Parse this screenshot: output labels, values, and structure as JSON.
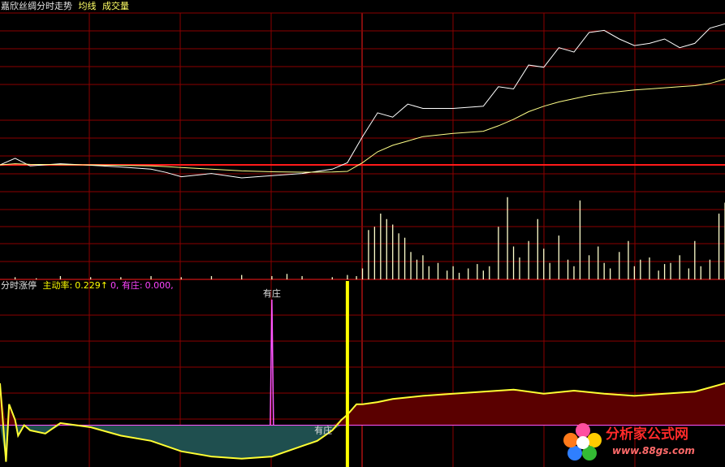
{
  "panel_top": {
    "title": "嘉欣丝绸分时走势",
    "legend": [
      "均线",
      "成交量"
    ],
    "legend_colors": [
      "#ffff66",
      "#ffff66"
    ]
  },
  "panel_indicator": {
    "name": "分时涨停",
    "metric_label": "主动率:",
    "metric_value": "0.229",
    "arrow": "↑",
    "second_value": "0,",
    "zhuang_label": "有庄:",
    "zhuang_value": "0.000,",
    "spike_label": "有庄",
    "base_label": "有庄"
  },
  "colors": {
    "background": "#000000",
    "grid": "#8b0000",
    "grid_bright": "#ff1a1a",
    "price_line": "#ffffff",
    "avg_line": "#ffff88",
    "volume_bar": "#ffffcc",
    "indicator_line": "#ffff33",
    "fill_below": "#1f4f4f",
    "fill_above": "#5a0000",
    "spike": "#ff55ff",
    "marker": "#ffff00",
    "text_white": "#e0e0e0",
    "text_yellow": "#ffff00",
    "text_magenta": "#ff44ff"
  },
  "watermark": {
    "name": "分析家公式网",
    "url": "www.88gs.com"
  },
  "chart_data": [
    {
      "type": "line",
      "title": "嘉欣丝绸分时走势",
      "x": [
        0,
        5,
        10,
        20,
        30,
        40,
        50,
        55,
        60,
        70,
        80,
        90,
        100,
        110,
        115,
        120,
        125,
        130,
        135,
        140,
        150,
        160,
        165,
        170,
        175,
        180,
        185,
        190,
        195,
        200,
        205,
        210,
        215,
        220,
        225,
        230,
        235,
        240
      ],
      "series": [
        {
          "name": "",
          "values": [
            0,
            0.3,
            -0.05,
            0.05,
            -0.02,
            -0.1,
            -0.2,
            -0.35,
            -0.55,
            -0.4,
            -0.6,
            -0.5,
            -0.4,
            -0.2,
            0.1,
            1.3,
            2.4,
            2.2,
            2.8,
            2.6,
            2.6,
            2.7,
            3.6,
            3.5,
            4.6,
            4.5,
            5.4,
            5.2,
            6.1,
            6.2,
            5.8,
            5.5,
            5.6,
            5.8,
            5.4,
            5.6,
            6.3,
            6.5
          ]
        },
        {
          "name": "均线",
          "values": [
            0,
            0.05,
            0.02,
            0.01,
            0,
            -0.02,
            -0.05,
            -0.08,
            -0.12,
            -0.2,
            -0.28,
            -0.32,
            -0.34,
            -0.33,
            -0.3,
            0.1,
            0.6,
            0.9,
            1.1,
            1.3,
            1.45,
            1.55,
            1.8,
            2.1,
            2.45,
            2.7,
            2.9,
            3.05,
            3.2,
            3.3,
            3.38,
            3.45,
            3.5,
            3.55,
            3.6,
            3.65,
            3.75,
            3.95
          ]
        }
      ],
      "ylim": [
        -1.2,
        7.0
      ],
      "xlim": [
        0,
        240
      ]
    },
    {
      "type": "bar",
      "title": "成交量",
      "x": [
        5,
        12,
        20,
        30,
        40,
        50,
        60,
        70,
        80,
        90,
        95,
        100,
        110,
        115,
        118,
        120,
        122,
        124,
        126,
        128,
        130,
        132,
        134,
        136,
        138,
        140,
        142,
        145,
        148,
        150,
        152,
        155,
        158,
        160,
        162,
        165,
        168,
        170,
        172,
        175,
        178,
        180,
        182,
        185,
        188,
        190,
        192,
        195,
        198,
        200,
        202,
        205,
        208,
        210,
        212,
        215,
        218,
        220,
        222,
        225,
        228,
        230,
        232,
        235,
        238,
        240
      ],
      "values": [
        2,
        1,
        3,
        2,
        2,
        3,
        2,
        3,
        4,
        3,
        5,
        3,
        2,
        4,
        3,
        10,
        45,
        48,
        60,
        55,
        50,
        42,
        38,
        25,
        18,
        22,
        12,
        15,
        8,
        12,
        6,
        10,
        14,
        8,
        12,
        48,
        75,
        30,
        20,
        35,
        55,
        28,
        15,
        40,
        18,
        12,
        72,
        22,
        30,
        15,
        10,
        25,
        35,
        12,
        18,
        20,
        8,
        14,
        15,
        22,
        10,
        35,
        12,
        18,
        60,
        70
      ],
      "ylim": [
        0,
        80
      ],
      "xlim": [
        0,
        240
      ]
    },
    {
      "type": "area",
      "title": "分时涨停",
      "x": [
        0,
        2,
        3,
        5,
        6,
        8,
        10,
        15,
        20,
        30,
        40,
        50,
        60,
        70,
        80,
        90,
        100,
        105,
        110,
        113,
        115,
        118,
        120,
        125,
        130,
        140,
        150,
        160,
        170,
        180,
        190,
        200,
        210,
        220,
        230,
        235,
        240
      ],
      "series": [
        {
          "name": "",
          "values": [
            0.4,
            -0.35,
            0.2,
            0.05,
            -0.1,
            0,
            -0.05,
            -0.08,
            0.02,
            -0.02,
            -0.1,
            -0.15,
            -0.25,
            -0.3,
            -0.32,
            -0.3,
            -0.2,
            -0.15,
            -0.05,
            0.05,
            0.1,
            0.2,
            0.2,
            0.22,
            0.25,
            0.28,
            0.3,
            0.32,
            0.34,
            0.3,
            0.33,
            0.3,
            0.28,
            0.3,
            0.32,
            0.36,
            0.4
          ]
        }
      ],
      "spike": {
        "x": 90,
        "value": 1.2
      },
      "marker_x": 115,
      "ylim": [
        -0.4,
        1.3
      ],
      "xlim": [
        0,
        240
      ]
    }
  ]
}
